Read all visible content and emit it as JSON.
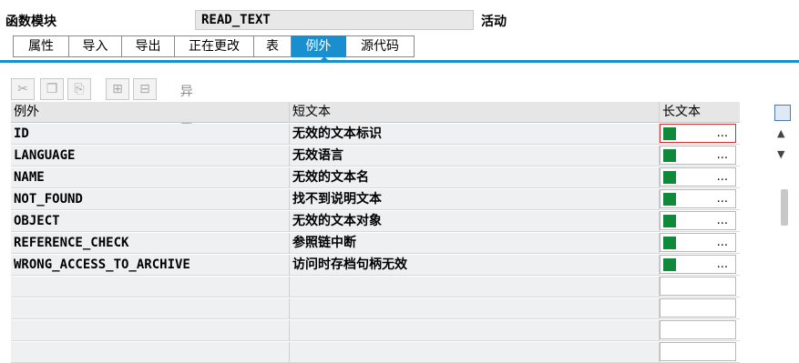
{
  "header": {
    "label": "函数模块",
    "module_name": "READ_TEXT",
    "status": "活动"
  },
  "tabs": [
    {
      "label": "属性",
      "active": false
    },
    {
      "label": "导入",
      "active": false
    },
    {
      "label": "导出",
      "active": false
    },
    {
      "label": "正在更改",
      "active": false
    },
    {
      "label": "表",
      "active": false
    },
    {
      "label": "例外",
      "active": true
    },
    {
      "label": "源代码",
      "active": false
    }
  ],
  "toolbar": {
    "buttons": [
      "cut-icon",
      "copy-icon",
      "paste-icon",
      "insert-row-icon",
      "delete-row-icon"
    ],
    "checkbox_label": "异常类",
    "checkbox_checked": false
  },
  "table": {
    "headers": {
      "col1": "例外",
      "col2": "短文本",
      "col3": "长文本"
    },
    "rows": [
      {
        "name": "ID",
        "short_text": "无效的文本标识",
        "longtext_button": "..."
      },
      {
        "name": "LANGUAGE",
        "short_text": "无效语言",
        "longtext_button": "..."
      },
      {
        "name": "NAME",
        "short_text": "无效的文本名",
        "longtext_button": "..."
      },
      {
        "name": "NOT_FOUND",
        "short_text": "找不到说明文本",
        "longtext_button": "..."
      },
      {
        "name": "OBJECT",
        "short_text": "无效的文本对象",
        "longtext_button": "..."
      },
      {
        "name": "REFERENCE_CHECK",
        "short_text": "参照链中断",
        "longtext_button": "..."
      },
      {
        "name": "WRONG_ACCESS_TO_ARCHIVE",
        "short_text": "访问时存档句柄无效",
        "longtext_button": "..."
      }
    ]
  },
  "colors": {
    "accent": "#1a8fd0",
    "status_green": "#108a3a"
  }
}
